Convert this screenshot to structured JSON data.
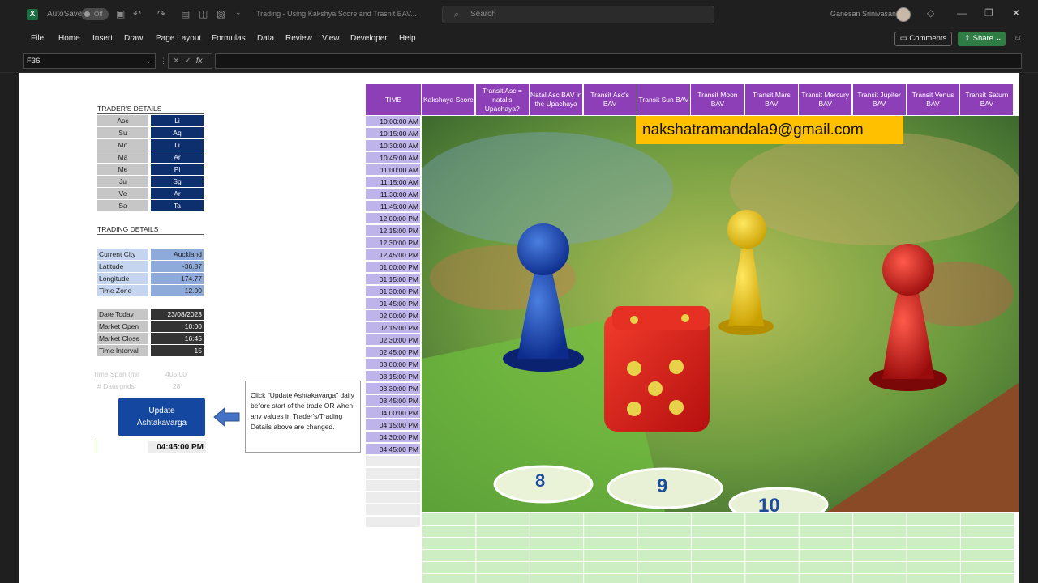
{
  "titlebar": {
    "autosave_label": "AutoSave",
    "autosave_state": "Off",
    "document_title": "Trading - Using Kakshya Score and Trasnit BAV...",
    "search_placeholder": "Search",
    "user_name": "Ganesan Srinivasan"
  },
  "ribbon": {
    "tabs": [
      "File",
      "Home",
      "Insert",
      "Draw",
      "Page Layout",
      "Formulas",
      "Data",
      "Review",
      "View",
      "Developer",
      "Help"
    ],
    "comments_label": "Comments",
    "share_label": "Share"
  },
  "formula_bar": {
    "name_box": "F36",
    "fx_label": "fx",
    "formula": ""
  },
  "traders_details": {
    "title": "TRADER'S DETAILS",
    "rows": [
      {
        "planet": "Asc",
        "sign": "Li"
      },
      {
        "planet": "Su",
        "sign": "Aq"
      },
      {
        "planet": "Mo",
        "sign": "Li"
      },
      {
        "planet": "Ma",
        "sign": "Ar"
      },
      {
        "planet": "Me",
        "sign": "Pi"
      },
      {
        "planet": "Ju",
        "sign": "Sg"
      },
      {
        "planet": "Ve",
        "sign": "Ar"
      },
      {
        "planet": "Sa",
        "sign": "Ta"
      }
    ]
  },
  "trading_details": {
    "title": "TRADING DETAILS",
    "location": [
      {
        "label": "Current City",
        "value": "Auckland"
      },
      {
        "label": "Latitude",
        "value": "-36.87"
      },
      {
        "label": "Longitude",
        "value": "174.77"
      },
      {
        "label": "Time Zone",
        "value": "12.00"
      }
    ],
    "market": [
      {
        "label": "Date Today",
        "value": "23/08/2023"
      },
      {
        "label": "Market Open",
        "value": "10:00"
      },
      {
        "label": "Market Close",
        "value": "16:45"
      },
      {
        "label": "Time Interval",
        "value": "15"
      }
    ],
    "time_span_label": "Time Span (mir",
    "time_span_value": "405.00",
    "data_grids_label": "# Data grids",
    "data_grids_value": "28"
  },
  "update_button": {
    "line1": "Update",
    "line2": "Ashtakavarga"
  },
  "current_time_result": "04:45:00 PM",
  "note": "Click \"Update Ashtakavarga\" daily before start of the trade OR when any values in Trader's/Trading Details above are changed.",
  "table": {
    "headers": [
      "TIME",
      "Kakshaya Score",
      "Transit Asc = natal's Upachaya?",
      "Natal Asc BAV in the Upachaya",
      "Transit Asc's  BAV",
      "Transit Sun BAV",
      "Transit Moon  BAV",
      "Transit Mars BAV",
      "Transit Mercury BAV",
      "Transit Jupiter BAV",
      "Transit Venus BAV",
      "Transit Saturn BAV"
    ],
    "times": [
      "10:00:00 AM",
      "10:15:00 AM",
      "10:30:00 AM",
      "10:45:00 AM",
      "11:00:00 AM",
      "11:15:00 AM",
      "11:30:00 AM",
      "11:45:00 AM",
      "12:00:00 PM",
      "12:15:00 PM",
      "12:30:00 PM",
      "12:45:00 PM",
      "01:00:00 PM",
      "01:15:00 PM",
      "01:30:00 PM",
      "01:45:00 PM",
      "02:00:00 PM",
      "02:15:00 PM",
      "02:30:00 PM",
      "02:45:00 PM",
      "03:00:00 PM",
      "03:15:00 PM",
      "03:30:00 PM",
      "03:45:00 PM",
      "04:00:00 PM",
      "04:15:00 PM",
      "04:30:00 PM",
      "04:45:00 PM"
    ]
  },
  "overlay": {
    "email": "nakshatramandala9@gmail.com",
    "board_numbers": [
      "8",
      "9",
      "10"
    ]
  },
  "colors": {
    "header_purple": "#8d3fb8",
    "time_lavender": "#bfb4ea",
    "planet_navy": "#0d2f6e",
    "button_blue": "#1347a0",
    "email_yellow": "#ffc000",
    "grid_green": "#cdeec2"
  }
}
